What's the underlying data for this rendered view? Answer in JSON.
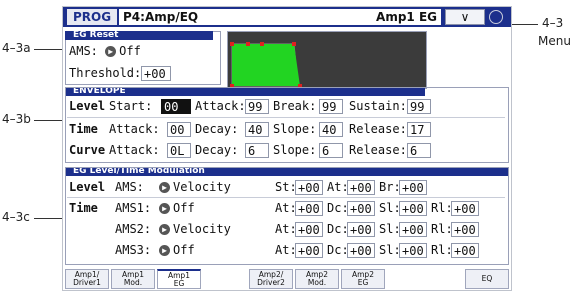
{
  "header": {
    "mode": "PROG",
    "page": "P4:Amp/EQ",
    "tab_name": "Amp1 EG",
    "menu_glyph": "∨"
  },
  "annotations": {
    "menu": "4–3",
    "menu_label": "Menu",
    "eg_reset": "4–3a",
    "envelope": "4–3b",
    "modulation": "4–3c"
  },
  "eg_reset": {
    "title": "EG Reset",
    "ams_label": "AMS:",
    "ams_value": "Off",
    "threshold_label": "Threshold:",
    "threshold_value": "+00"
  },
  "envelope": {
    "title": "ENVELOPE",
    "level": {
      "row": "Level",
      "start_label": "Start:",
      "start": "00",
      "attack_label": "Attack:",
      "attack": "99",
      "break_label": "Break:",
      "break": "99",
      "sustain_label": "Sustain:",
      "sustain": "99"
    },
    "time": {
      "row": "Time",
      "attack_label": "Attack:",
      "attack": "00",
      "decay_label": "Decay:",
      "decay": "40",
      "slope_label": "Slope:",
      "slope": "40",
      "release_label": "Release:",
      "release": "17"
    },
    "curve": {
      "row": "Curve",
      "attack_label": "Attack:",
      "attack": "0L",
      "decay_label": "Decay:",
      "decay": "6",
      "slope_label": "Slope:",
      "slope": "6",
      "release_label": "Release:",
      "release": "6"
    }
  },
  "modulation": {
    "title": "EG Level/Time Modulation",
    "level": {
      "row": "Level",
      "ams_label": "AMS:",
      "ams_value": "Velocity",
      "st_label": "St:",
      "st": "+00",
      "at_label": "At:",
      "at": "+00",
      "br_label": "Br:",
      "br": "+00"
    },
    "time": {
      "row": "Time",
      "rows": [
        {
          "label": "AMS1:",
          "value": "Off",
          "at": "+00",
          "dc": "+00",
          "sl": "+00",
          "rl": "+00"
        },
        {
          "label": "AMS2:",
          "value": "Velocity",
          "at": "+00",
          "dc": "+00",
          "sl": "+00",
          "rl": "+00"
        },
        {
          "label": "AMS3:",
          "value": "Off",
          "at": "+00",
          "dc": "+00",
          "sl": "+00",
          "rl": "+00"
        }
      ],
      "at_label": "At:",
      "dc_label": "Dc:",
      "sl_label": "Sl:",
      "rl_label": "Rl:"
    }
  },
  "tabs": [
    {
      "l1": "Amp1/",
      "l2": "Driver1"
    },
    {
      "l1": "Amp1",
      "l2": "Mod."
    },
    {
      "l1": "Amp1",
      "l2": "EG"
    },
    {
      "l1": "Amp2/",
      "l2": "Driver2"
    },
    {
      "l1": "Amp2",
      "l2": "Mod."
    },
    {
      "l1": "Amp2",
      "l2": "EG"
    },
    {
      "l1": "EQ",
      "l2": ""
    }
  ],
  "colors": {
    "header": "#1c2f8c",
    "eg_fill": "#22d422",
    "eg_bg": "#3b3b3b",
    "eg_point": "#e02020"
  }
}
